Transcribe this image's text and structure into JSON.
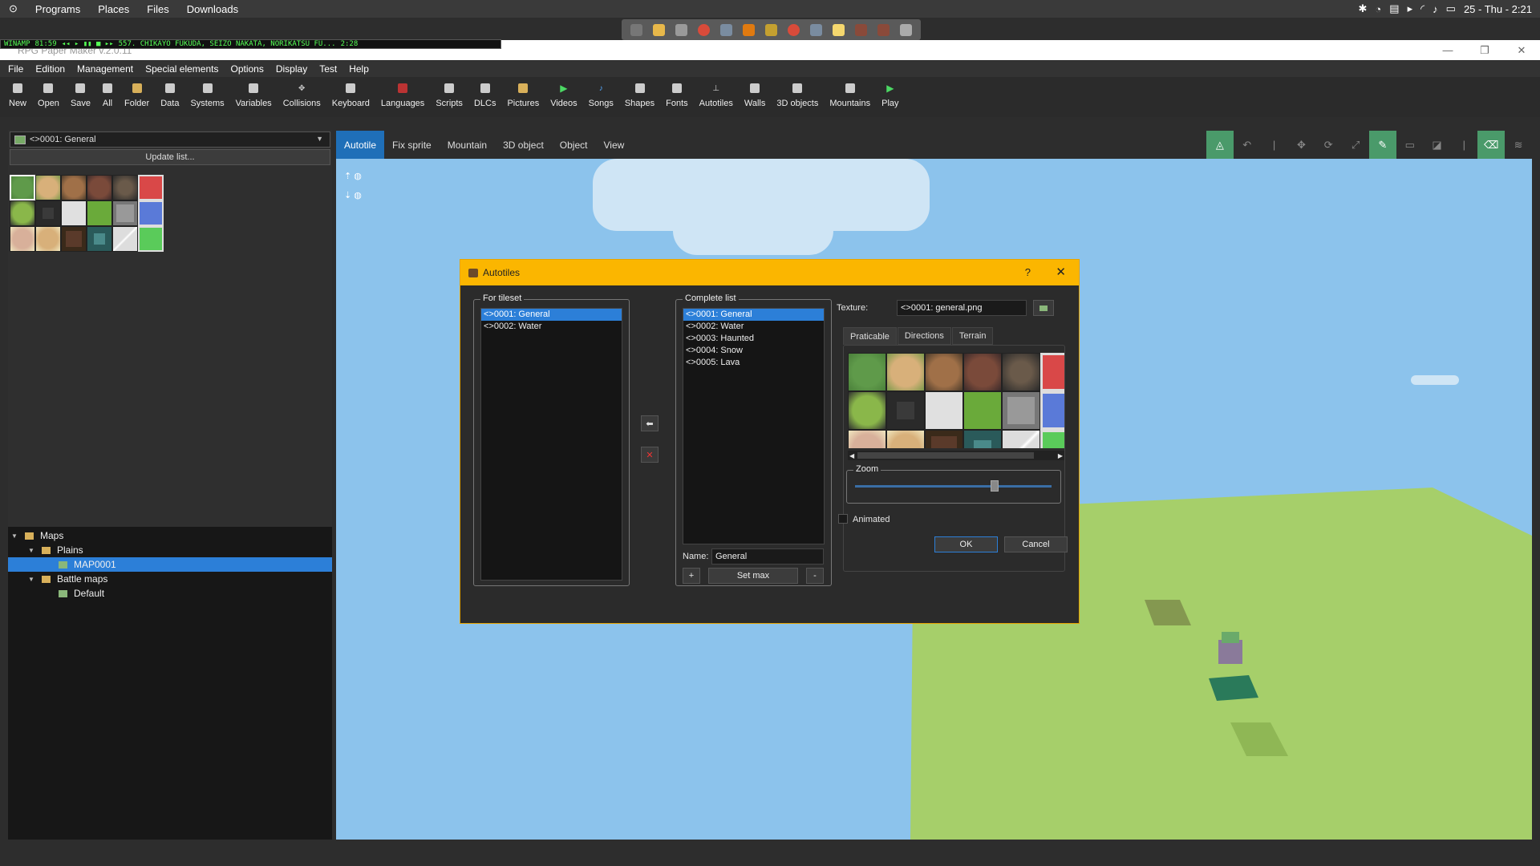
{
  "topbar": {
    "activities": "⊙",
    "items": [
      "Programs",
      "Places",
      "Files",
      "Downloads"
    ],
    "clock": "25 - Thu - 2:21"
  },
  "winamp": {
    "title": "WINAMP",
    "time": "81:59",
    "track": "557. CHIKAYO FUKUDA, SEIZO NAKATA, NORIKATSU FU...",
    "duration": "2:28"
  },
  "window": {
    "title": "RPG Paper Maker v.2.0.11"
  },
  "menu": [
    "File",
    "Edition",
    "Management",
    "Special elements",
    "Options",
    "Display",
    "Test",
    "Help"
  ],
  "toolbar": [
    "New",
    "Open",
    "Save",
    "All",
    "Folder",
    "Data",
    "Systems",
    "Variables",
    "Collisions",
    "Keyboard",
    "Languages",
    "Scripts",
    "DLCs",
    "Pictures",
    "Videos",
    "Songs",
    "Shapes",
    "Fonts",
    "Autotiles",
    "Walls",
    "3D objects",
    "Mountains",
    "Play"
  ],
  "left": {
    "selector": "<>0001: General",
    "update_label": "Update list...",
    "tree": [
      {
        "label": "Maps",
        "level": 0,
        "kind": "folder",
        "expanded": true
      },
      {
        "label": "Plains",
        "level": 1,
        "kind": "folder",
        "expanded": true
      },
      {
        "label": "MAP0001",
        "level": 2,
        "kind": "map",
        "selected": true
      },
      {
        "label": "Battle maps",
        "level": 1,
        "kind": "folder",
        "expanded": true
      },
      {
        "label": "Default",
        "level": 2,
        "kind": "map"
      }
    ]
  },
  "tabs": [
    "Autotile",
    "Fix sprite",
    "Mountain",
    "3D object",
    "Object",
    "View"
  ],
  "active_tab": "Autotile",
  "dialog": {
    "title": "Autotiles",
    "help": "?",
    "close": "✕",
    "for_tileset_label": "For tileset",
    "for_tileset": [
      "<>0001: General",
      "<>0002: Water"
    ],
    "complete_label": "Complete list",
    "complete": [
      "<>0001: General",
      "<>0002: Water",
      "<>0003: Haunted",
      "<>0004: Snow",
      "<>0005: Lava"
    ],
    "name_label": "Name:",
    "name_value": "General",
    "add": "+",
    "setmax": "Set max",
    "remove": "-",
    "texture_label": "Texture:",
    "texture_value": "<>0001: general.png",
    "tabs": [
      "Praticable",
      "Directions",
      "Terrain"
    ],
    "zoom_label": "Zoom",
    "zoom_level": 0.72,
    "animated_label": "Animated",
    "ok": "OK",
    "cancel": "Cancel"
  },
  "colors": {
    "accent": "#2c7fd8",
    "dialog_title": "#fbb600",
    "sky": "#8cc3ec",
    "grass": "#a6cf6a"
  }
}
